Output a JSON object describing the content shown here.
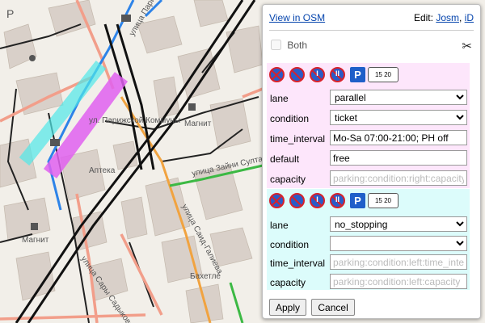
{
  "map": {
    "labels": {
      "ul_parizhskoy_kommuny": "ул. Парижской Коммуны",
      "magnit_1": "Магнит",
      "magnit_2": "Магнит",
      "ulitsa_zainy_sultan": "улица Зайни Султан",
      "ulitsa_said_galieva": "улица Саид-Галиева",
      "ulitsa_sary_sadykovoy": "улица Сары Садыковой",
      "bakhetle": "Бахетле",
      "aptaka": "Аптека",
      "ulitsa_parizhskoy_top": "улица Парижской Коммуны",
      "p_label": "P"
    }
  },
  "panel": {
    "view_in_osm": "View in OSM",
    "edit_label": "Edit:",
    "josm": "Josm",
    "id": "iD",
    "both_label": "Both",
    "scissors": "✂",
    "right": {
      "signs": {
        "parking_symbol": "P",
        "time_symbol": "15 20"
      },
      "fields": {
        "lane": {
          "label": "lane",
          "value": "parallel"
        },
        "condition": {
          "label": "condition",
          "value": "ticket"
        },
        "time_interval": {
          "label": "time_interval",
          "value": "Mo-Sa 07:00-21:00; PH off"
        },
        "default": {
          "label": "default",
          "value": "free"
        },
        "capacity": {
          "label": "capacity",
          "placeholder": "parking:condition:right:capacity"
        }
      }
    },
    "left": {
      "signs": {
        "parking_symbol": "P",
        "time_symbol": "15 20"
      },
      "fields": {
        "lane": {
          "label": "lane",
          "value": "no_stopping"
        },
        "condition": {
          "label": "condition",
          "value": ""
        },
        "time_interval": {
          "label": "time_interval",
          "placeholder": "parking:condition:left:time_interval"
        },
        "capacity": {
          "label": "capacity",
          "placeholder": "parking:condition:left:capacity"
        }
      }
    },
    "buttons": {
      "apply": "Apply",
      "cancel": "Cancel"
    }
  },
  "colors": {
    "highlight_right": "#fde6fb",
    "highlight_left": "#dcfcfb",
    "map_magenta": "#e060f0",
    "map_cyan": "#50e8e8",
    "link": "#0645ad"
  }
}
